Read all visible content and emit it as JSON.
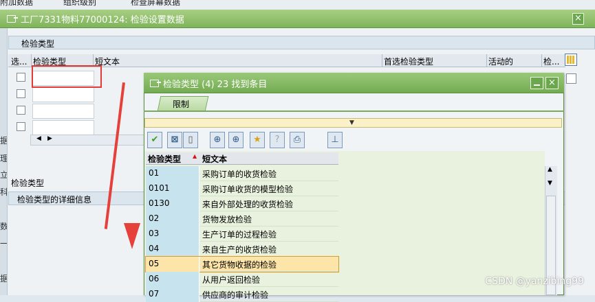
{
  "topbar": {
    "items": [
      "附加数据",
      "组织级别",
      "检查屏幕数据"
    ]
  },
  "window": {
    "title": "工厂7331物料77000124: 检验设置数据",
    "close": "×"
  },
  "left_strip": [
    "据",
    "理",
    "立",
    "科",
    "数",
    "一",
    "据"
  ],
  "section": {
    "title": "检验类型"
  },
  "table": {
    "columns": [
      "选...",
      "检验类型",
      "短文本",
      "首选检验类型",
      "活动的",
      "检..."
    ],
    "rows": 4
  },
  "sub_label": "检验类型",
  "detail": {
    "title": "检验类型的详细信息"
  },
  "popup": {
    "title": "检验类型 (4)   23 找到条目",
    "tab": "限制",
    "toolbar": [
      "check-icon",
      "cancel-icon",
      "new-icon",
      "binoculars-icon",
      "binoculars-next-icon",
      "star-icon",
      "help-icon",
      "print-icon",
      "pin-icon"
    ],
    "columns": [
      "检验类型",
      "短文本"
    ],
    "rows": [
      {
        "code": "01",
        "text": "采购订单的收货检验"
      },
      {
        "code": "0101",
        "text": "采购订单收货的模型检验"
      },
      {
        "code": "0130",
        "text": "来自外部处理的收货检验"
      },
      {
        "code": "02",
        "text": "货物发放检验"
      },
      {
        "code": "03",
        "text": "生产订单的过程检验"
      },
      {
        "code": "04",
        "text": "来自生产的收货检验"
      },
      {
        "code": "05",
        "text": "其它货物收据的检验"
      },
      {
        "code": "06",
        "text": "从用户返回检验"
      },
      {
        "code": "07",
        "text": "供应商的审计检验"
      }
    ],
    "selected_index": 6
  },
  "watermark": "CSDN @yanzibing99",
  "colors": {
    "title_green": "#7fb55b",
    "selection": "#fde4a8",
    "annotation_red": "#e5413a"
  }
}
